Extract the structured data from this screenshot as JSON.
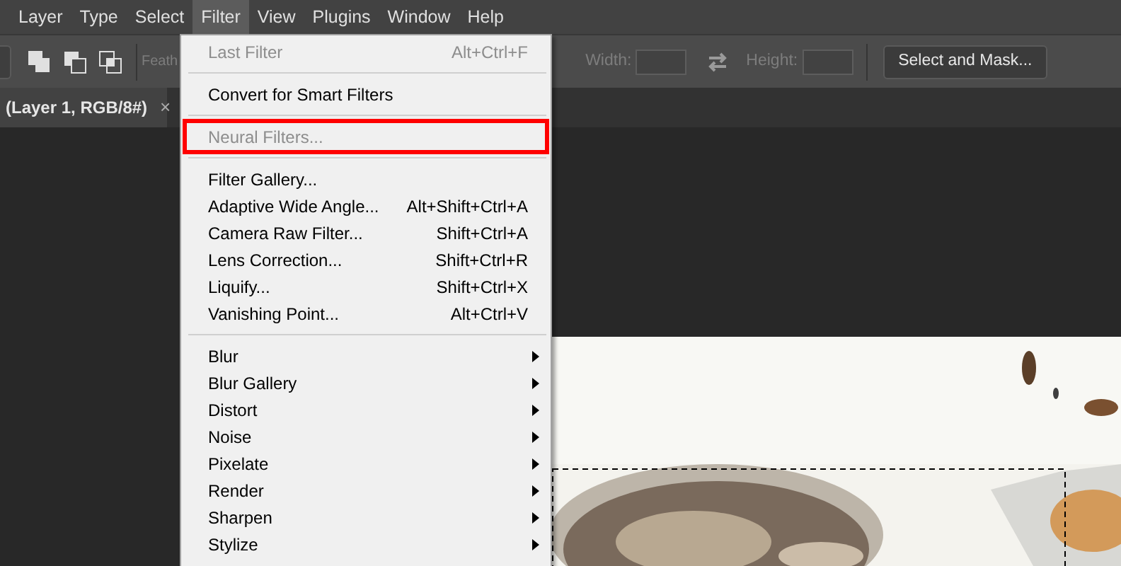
{
  "menu_bar": [
    {
      "label": "Layer",
      "selected": false
    },
    {
      "label": "Type",
      "selected": false
    },
    {
      "label": "Select",
      "selected": false
    },
    {
      "label": "Filter",
      "selected": true
    },
    {
      "label": "View",
      "selected": false
    },
    {
      "label": "Plugins",
      "selected": false
    },
    {
      "label": "Window",
      "selected": false
    },
    {
      "label": "Help",
      "selected": false
    }
  ],
  "options_bar": {
    "feather_label": "Feath",
    "width_label": "Width:",
    "height_label": "Height:",
    "select_and_mask_button": "Select and Mask..."
  },
  "document_tab": {
    "title": "(Layer 1, RGB/8#)",
    "close": "×"
  },
  "filter_menu": [
    {
      "kind": "item",
      "label": "Last Filter",
      "shortcut": "Alt+Ctrl+F",
      "disabled": true,
      "highlighted": false
    },
    {
      "kind": "separator"
    },
    {
      "kind": "item",
      "label": "Convert for Smart Filters",
      "disabled": false,
      "highlighted": false
    },
    {
      "kind": "separator"
    },
    {
      "kind": "item",
      "label": "Neural Filters...",
      "disabled": true,
      "highlighted": true
    },
    {
      "kind": "separator"
    },
    {
      "kind": "item",
      "label": "Filter Gallery...",
      "disabled": false,
      "highlighted": false
    },
    {
      "kind": "item",
      "label": "Adaptive Wide Angle...",
      "shortcut": "Alt+Shift+Ctrl+A",
      "disabled": false,
      "highlighted": false
    },
    {
      "kind": "item",
      "label": "Camera Raw Filter...",
      "shortcut": "Shift+Ctrl+A",
      "disabled": false,
      "highlighted": false
    },
    {
      "kind": "item",
      "label": "Lens Correction...",
      "shortcut": "Shift+Ctrl+R",
      "disabled": false,
      "highlighted": false
    },
    {
      "kind": "item",
      "label": "Liquify...",
      "shortcut": "Shift+Ctrl+X",
      "disabled": false,
      "highlighted": false
    },
    {
      "kind": "item",
      "label": "Vanishing Point...",
      "shortcut": "Alt+Ctrl+V",
      "disabled": false,
      "highlighted": false
    },
    {
      "kind": "separator"
    },
    {
      "kind": "submenu",
      "label": "Blur",
      "disabled": false,
      "highlighted": false
    },
    {
      "kind": "submenu",
      "label": "Blur Gallery",
      "disabled": false,
      "highlighted": false
    },
    {
      "kind": "submenu",
      "label": "Distort",
      "disabled": false,
      "highlighted": false
    },
    {
      "kind": "submenu",
      "label": "Noise",
      "disabled": false,
      "highlighted": false
    },
    {
      "kind": "submenu",
      "label": "Pixelate",
      "disabled": false,
      "highlighted": false
    },
    {
      "kind": "submenu",
      "label": "Render",
      "disabled": false,
      "highlighted": false
    },
    {
      "kind": "submenu",
      "label": "Sharpen",
      "disabled": false,
      "highlighted": false
    },
    {
      "kind": "submenu",
      "label": "Stylize",
      "disabled": false,
      "highlighted": false
    }
  ]
}
